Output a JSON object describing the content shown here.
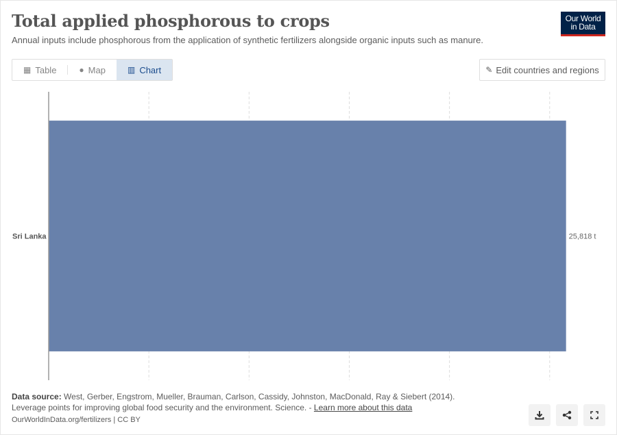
{
  "header": {
    "title": "Total applied phosphorous to crops",
    "subtitle": "Annual inputs include phosphorous from the application of synthetic fertilizers alongside organic inputs such as manure.",
    "logo_line1": "Our World",
    "logo_line2": "in Data"
  },
  "tabs": [
    {
      "label": "Table",
      "icon": "table-icon"
    },
    {
      "label": "Map",
      "icon": "globe-icon"
    },
    {
      "label": "Chart",
      "icon": "chart-icon",
      "active": true
    }
  ],
  "edit_button": {
    "label": "Edit countries and regions",
    "icon": "pencil-icon"
  },
  "chart_data": {
    "type": "bar",
    "orientation": "horizontal",
    "categories": [
      "Sri Lanka"
    ],
    "values": [
      25818
    ],
    "value_labels": [
      "25,818 t"
    ],
    "xlim": [
      0,
      26000
    ],
    "grid": true,
    "color": "#6881ab"
  },
  "footer": {
    "source_label": "Data source:",
    "source_text": "West, Gerber, Engstrom, Mueller, Brauman, Carlson, Cassidy, Johnston, MacDonald, Ray & Siebert (2014).",
    "source_line2": "Leverage points for improving global food security and the environment. Science. - ",
    "learn_more": "Learn more about this data",
    "site": "OurWorldInData.org/fertilizers | CC BY"
  },
  "footer_buttons": [
    {
      "name": "download-button",
      "icon": "download-icon"
    },
    {
      "name": "share-button",
      "icon": "share-icon"
    },
    {
      "name": "fullscreen-button",
      "icon": "expand-icon"
    }
  ]
}
